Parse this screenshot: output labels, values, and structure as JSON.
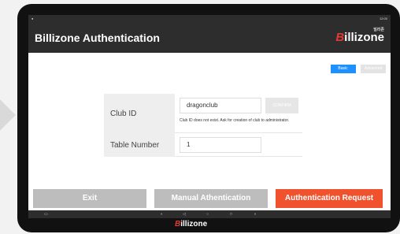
{
  "app": {
    "title": "Billizone Authentication",
    "brand": "Billizone",
    "brand_korean": "빌리존"
  },
  "statusbar": {
    "time": "12:00"
  },
  "tabs": {
    "basic": "Basic",
    "advanced": "Advanced"
  },
  "form": {
    "club_id_label": "Club ID",
    "club_id_value": "dragonclub",
    "confirm_label": "CONFIRM",
    "club_id_error": "Club ID does not exist. Ask for creation of club to administrator.",
    "table_number_label": "Table Number",
    "table_number_value": "1"
  },
  "buttons": {
    "exit": "Exit",
    "manual": "Manual Athentication",
    "auth": "Authentication Request"
  },
  "colors": {
    "accent": "#f0522e",
    "primary": "#1e90ff",
    "bar": "#2d2d2d"
  }
}
